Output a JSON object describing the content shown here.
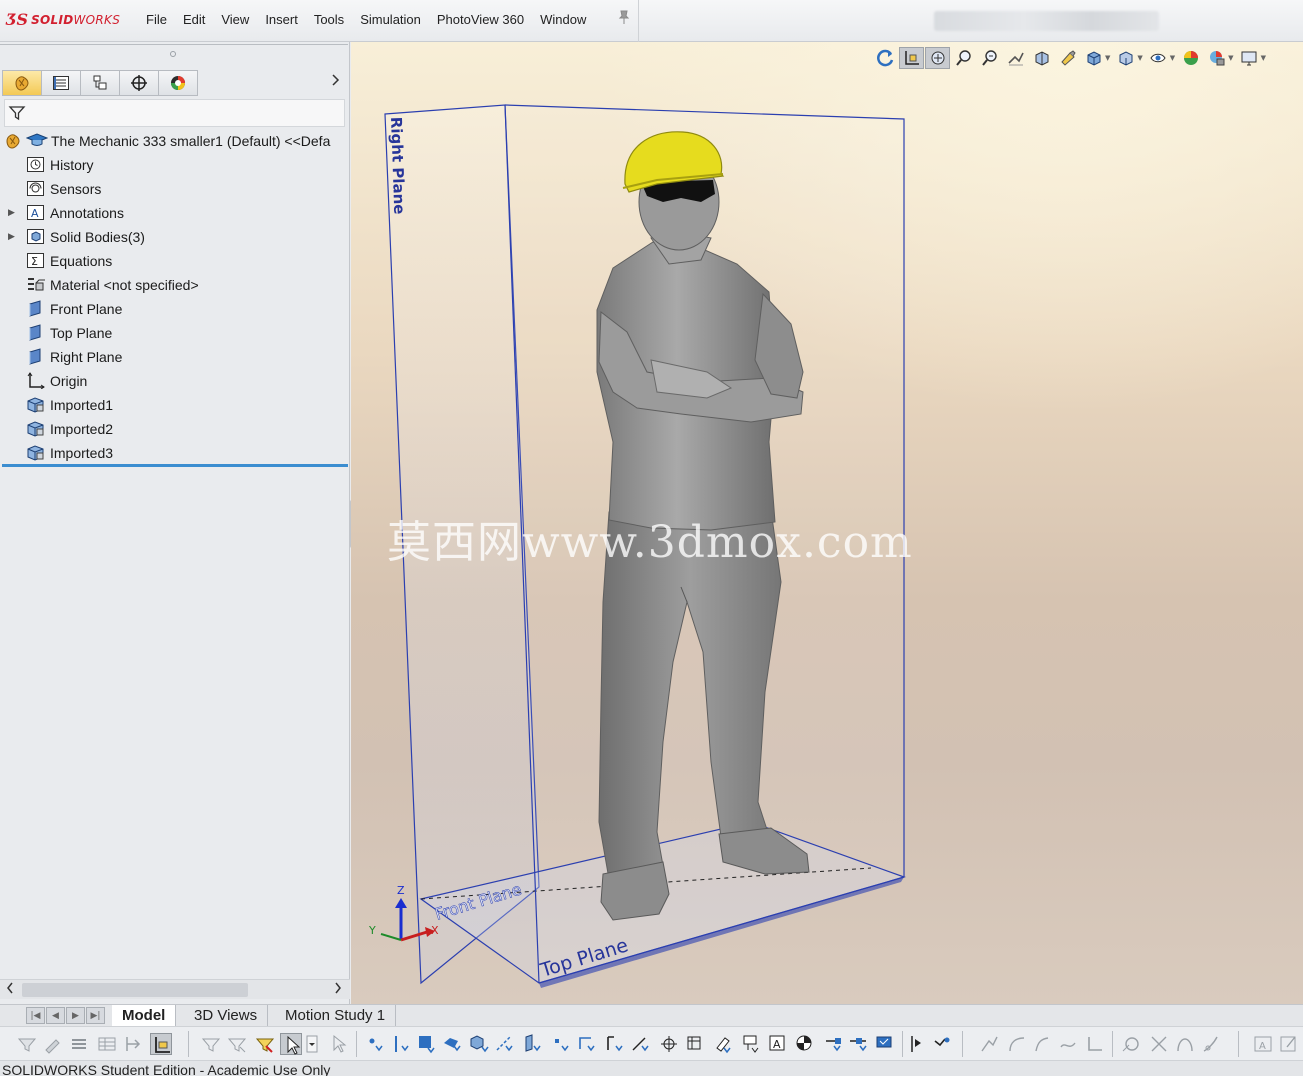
{
  "app": {
    "logo_ds": "ƷS",
    "logo_brand_bold": "SOLID",
    "logo_brand": "WORKS"
  },
  "menu": [
    "File",
    "Edit",
    "View",
    "Insert",
    "Tools",
    "Simulation",
    "PhotoView 360",
    "Window"
  ],
  "feature_tree": {
    "root": "The Mechanic 333 smaller1 (Default) <<Defa",
    "items": [
      {
        "label": "History",
        "icon": "history-icon",
        "expandable": false
      },
      {
        "label": "Sensors",
        "icon": "sensors-icon",
        "expandable": false
      },
      {
        "label": "Annotations",
        "icon": "annotations-icon",
        "expandable": true
      },
      {
        "label": "Solid Bodies(3)",
        "icon": "solid-bodies-icon",
        "expandable": true
      },
      {
        "label": "Equations",
        "icon": "equations-icon",
        "expandable": false
      },
      {
        "label": "Material <not specified>",
        "icon": "material-icon",
        "expandable": false
      },
      {
        "label": "Front Plane",
        "icon": "plane-icon",
        "expandable": false
      },
      {
        "label": "Top Plane",
        "icon": "plane-icon",
        "expandable": false
      },
      {
        "label": "Right Plane",
        "icon": "plane-icon",
        "expandable": false
      },
      {
        "label": "Origin",
        "icon": "origin-icon",
        "expandable": false
      },
      {
        "label": "Imported1",
        "icon": "imported-body-icon",
        "expandable": false
      },
      {
        "label": "Imported2",
        "icon": "imported-body-icon",
        "expandable": false
      },
      {
        "label": "Imported3",
        "icon": "imported-body-icon",
        "expandable": false
      }
    ]
  },
  "viewport": {
    "plane_labels": {
      "right": "Right Plane",
      "front": "Front Plane",
      "top": "Top Plane"
    },
    "triad": {
      "x": "X",
      "y": "Y",
      "z": "Z"
    },
    "watermark": "莫西网www.3dmox.com",
    "model_color": "#8f8f8f",
    "helmet_color": "#e6dc1e",
    "plane_color": "#2b3fb0"
  },
  "bottom_tabs": [
    {
      "label": "Model",
      "active": true
    },
    {
      "label": "3D Views",
      "active": false
    },
    {
      "label": "Motion Study 1",
      "active": false
    }
  ],
  "status": "SOLIDWORKS Student Edition - Academic Use Only"
}
